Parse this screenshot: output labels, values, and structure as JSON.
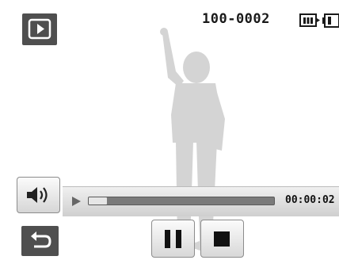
{
  "top_bar": {
    "file_number": "100-0002",
    "playback_icon": "play-mode-icon",
    "storage_icon": "internal-memory-icon",
    "battery_icon": "battery-icon"
  },
  "background": {
    "image": "child-pointing-silhouette"
  },
  "playback": {
    "elapsed_time": "00:00:02",
    "progress_fraction": 0.1
  },
  "controls": {
    "volume_icon": "volume-icon",
    "back_icon": "back-icon",
    "pause_icon": "pause-icon",
    "stop_icon": "stop-icon"
  },
  "colors": {
    "button_dark": "#4f4f4f",
    "silhouette": "#d4d4d4",
    "track": "#7a7a7a"
  }
}
